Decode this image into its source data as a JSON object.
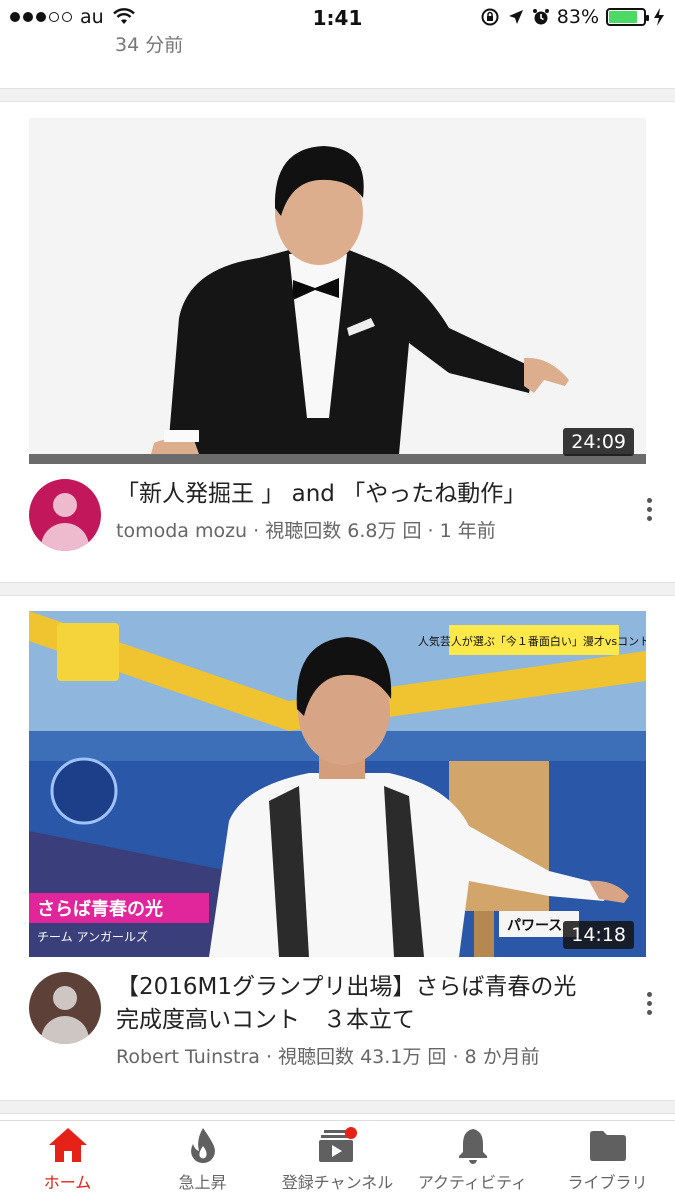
{
  "status_bar": {
    "carrier": "au",
    "time": "1:41",
    "battery": "83%",
    "battery_level": 0.83
  },
  "feed": {
    "previous_item_meta": "34 分前",
    "videos": [
      {
        "duration": "24:09",
        "title": "「新人発掘王 」 and 「やったね動作」",
        "channel": "tomoda mozu",
        "meta": "tomoda mozu · 視聴回数 6.8万 回 · 1 年前",
        "avatar_color": "#c2185b"
      },
      {
        "duration": "14:18",
        "title": "【2016M1グランプリ出場】さらば青春の光　完成度高いコント　３本立て",
        "channel": "Robert Tuinstra",
        "meta": "Robert Tuinstra · 視聴回数 43.1万 回 · 8 か月前",
        "avatar_color": "#5d4037",
        "overlay_top_right": "人気芸人が選ぶ「今１番面白い」漫才vsコント",
        "overlay_bottom_left": "さらば青春の光",
        "overlay_bottom_left_sub": "チーム アンガールズ",
        "overlay_bottom_right": "パワース"
      }
    ]
  },
  "bottom_nav": {
    "items": [
      {
        "label": "ホーム",
        "icon": "home-icon"
      },
      {
        "label": "急上昇",
        "icon": "flame-icon"
      },
      {
        "label": "登録チャンネル",
        "icon": "subscriptions-icon"
      },
      {
        "label": "アクティビティ",
        "icon": "bell-icon"
      },
      {
        "label": "ライブラリ",
        "icon": "folder-icon"
      }
    ]
  },
  "colors": {
    "accent": "#e62117",
    "battery": "#4cd964"
  }
}
